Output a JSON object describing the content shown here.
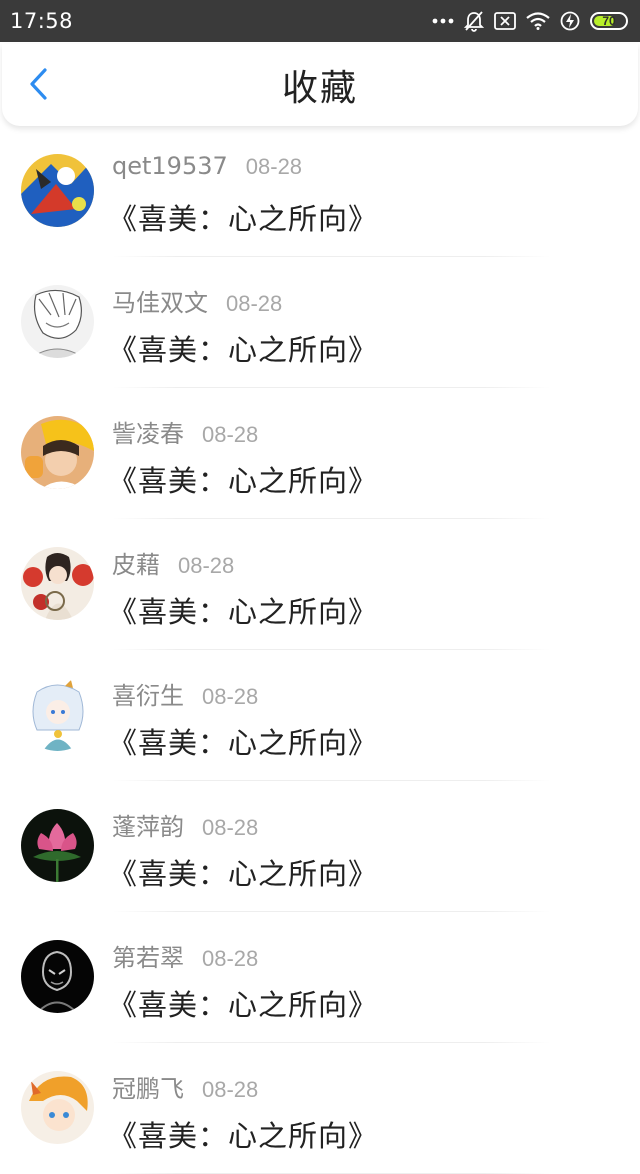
{
  "status_bar": {
    "time": "17:58",
    "battery": 70,
    "icons": [
      "more-dots-icon",
      "mute-bell-icon",
      "sim-error-icon",
      "wifi-icon",
      "charging-icon",
      "battery-icon"
    ]
  },
  "header": {
    "title": "收藏",
    "back_icon": "chevron-left-icon",
    "accent_color": "#2d8cf0"
  },
  "favorites": [
    {
      "name": "qet19537",
      "date": "08-28",
      "title": "《喜美：心之所向》",
      "avatar": "avatar-colorful-anime"
    },
    {
      "name": "马佳双文",
      "date": "08-28",
      "title": "《喜美：心之所向》",
      "avatar": "avatar-sketch"
    },
    {
      "name": "訾凌春",
      "date": "08-28",
      "title": "《喜美：心之所向》",
      "avatar": "avatar-girl-yellow-hat"
    },
    {
      "name": "皮藉",
      "date": "08-28",
      "title": "《喜美：心之所向》",
      "avatar": "avatar-red-flowers"
    },
    {
      "name": "喜衍生",
      "date": "08-28",
      "title": "《喜美：心之所向》",
      "avatar": "avatar-white-hair-anime"
    },
    {
      "name": "蓬萍韵",
      "date": "08-28",
      "title": "《喜美：心之所向》",
      "avatar": "avatar-lotus"
    },
    {
      "name": "第若翠",
      "date": "08-28",
      "title": "《喜美：心之所向》",
      "avatar": "avatar-dark-figure"
    },
    {
      "name": "冠鹏飞",
      "date": "08-28",
      "title": "《喜美：心之所向》",
      "avatar": "avatar-orange-anime"
    }
  ]
}
